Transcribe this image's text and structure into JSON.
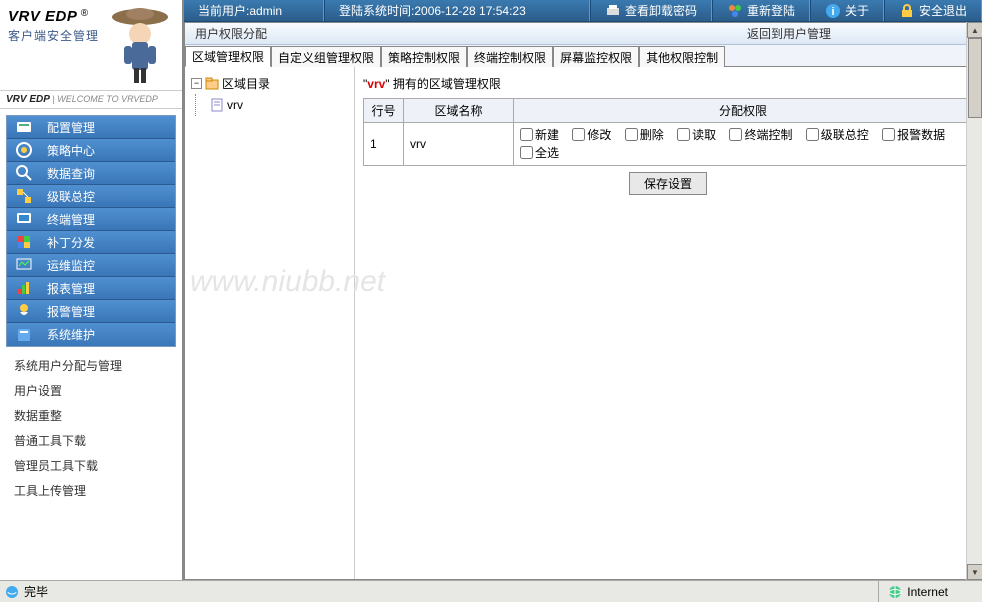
{
  "topbar": {
    "current_user_label": "当前用户:",
    "current_user": "admin",
    "login_time_label": "登陆系统时间:",
    "login_time": "2006-12-28 17:54:23",
    "view_pwd": "查看卸载密码",
    "relogin": "重新登陆",
    "about": "关于",
    "exit": "安全退出"
  },
  "brand": {
    "title": "VRV EDP",
    "reg": "®",
    "sub": "客户端安全管理",
    "welcome_brand": "VRV EDP",
    "welcome_text": " | WELCOME TO VRVEDP"
  },
  "nav": {
    "items": [
      {
        "label": "配置管理"
      },
      {
        "label": "策略中心"
      },
      {
        "label": "数据查询"
      },
      {
        "label": "级联总控"
      },
      {
        "label": "终端管理"
      },
      {
        "label": "补丁分发"
      },
      {
        "label": "运维监控"
      },
      {
        "label": "报表管理"
      },
      {
        "label": "报警管理"
      },
      {
        "label": "系统维护"
      }
    ]
  },
  "sublist": {
    "items": [
      "系统用户分配与管理",
      "用户设置",
      "数据重整",
      "普通工具下载",
      "管理员工具下载",
      "工具上传管理"
    ]
  },
  "page": {
    "title": "用户权限分配",
    "back": "返回到用户管理"
  },
  "tabs": [
    "区域管理权限",
    "自定义组管理权限",
    "策略控制权限",
    "终端控制权限",
    "屏幕监控权限",
    "其他权限控制"
  ],
  "tree": {
    "root": "区域目录",
    "child": "vrv"
  },
  "detail": {
    "quote_l": "\"",
    "node": "vrv",
    "quote_r": "\"",
    "suffix": " 拥有的区域管理权限"
  },
  "table": {
    "headers": [
      "行号",
      "区域名称",
      "分配权限"
    ],
    "row": {
      "num": "1",
      "name": "vrv",
      "perms": [
        "新建",
        "修改",
        "删除",
        "读取",
        "终端控制",
        "级联总控",
        "报警数据",
        "全选"
      ]
    },
    "save": "保存设置"
  },
  "status": {
    "done": "完毕",
    "zone": "Internet"
  },
  "watermark": "www.niubb.net"
}
